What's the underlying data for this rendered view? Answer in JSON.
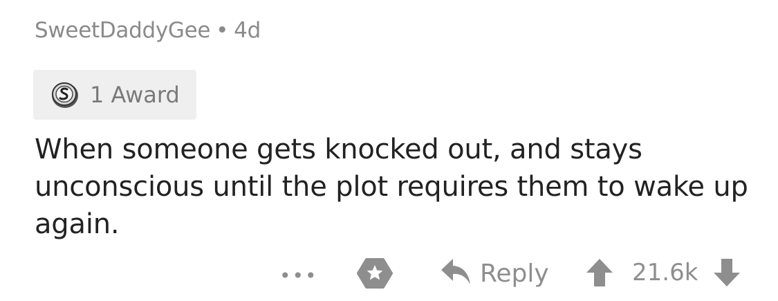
{
  "comment": {
    "author": "SweetDaddyGee",
    "separator": "•",
    "age": "4d",
    "award_label": "1 Award",
    "body": "When someone gets knocked out, and stays unconscious until the plot requires them to wake up again."
  },
  "actions": {
    "more_label": "•••",
    "reply_label": "Reply",
    "score": "21.6k"
  },
  "icons": {
    "award": "silver-award-icon",
    "give_award": "award-icon",
    "reply": "reply-arrow-icon",
    "upvote": "upvote-arrow-icon",
    "downvote": "downvote-arrow-icon",
    "more": "more-options-icon"
  },
  "colors": {
    "meta_text": "#8a8a8a",
    "body_text": "#222222",
    "action_icon": "#8e8e8e",
    "award_background": "#efefef"
  }
}
